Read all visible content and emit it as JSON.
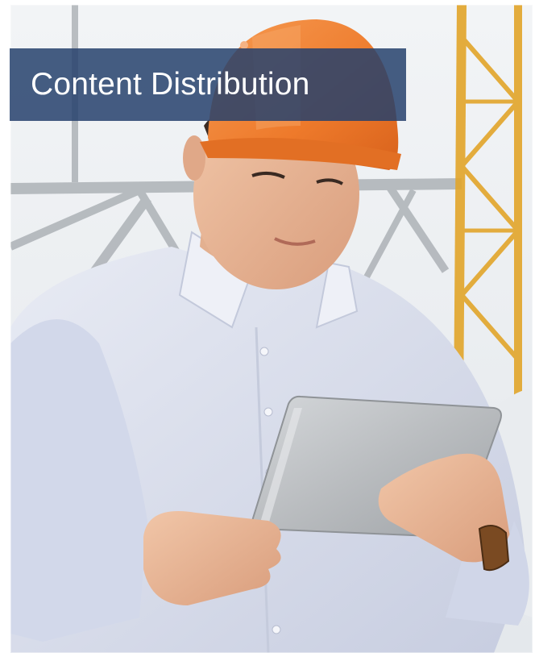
{
  "banner": {
    "title": "Content Distribution",
    "background_color": "#26416c"
  },
  "photo": {
    "subject": "construction-worker-with-tablet",
    "hardhat_color": "#ee7a2b",
    "shirt_color": "#dce1ef",
    "tablet_color": "#b9bcbf",
    "crane_color": "#e2a52a"
  }
}
